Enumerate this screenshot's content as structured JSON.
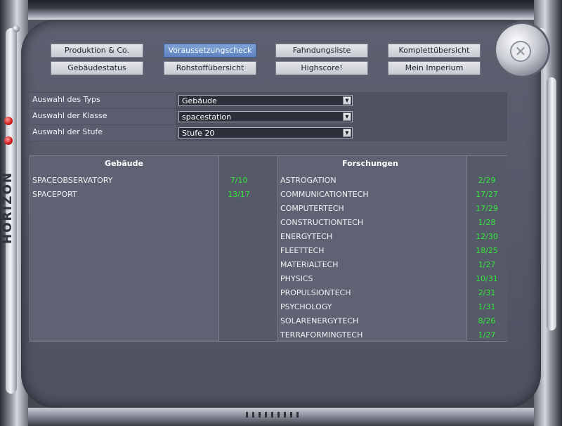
{
  "brand": "HORIZON",
  "nav": {
    "row1": [
      "Produktion & Co.",
      "Voraussetzungscheck",
      "Fahndungsliste",
      "Komplettübersicht"
    ],
    "row2": [
      "Gebäudestatus",
      "Rohstoffübersicht",
      "Highscore!",
      "Mein Imperium"
    ],
    "active": "Voraussetzungscheck"
  },
  "selector": {
    "type_label": "Auswahl des Typs",
    "type_value": "Gebäude",
    "class_label": "Auswahl der Klasse",
    "class_value": "spacestation",
    "level_label": "Auswahl der Stufe",
    "level_value": "Stufe 20"
  },
  "table": {
    "buildings_header": "Gebäude",
    "research_header": "Forschungen",
    "buildings": [
      {
        "name": "SPACEOBSERVATORY",
        "value": "7/10"
      },
      {
        "name": "SPACEPORT",
        "value": "13/17"
      }
    ],
    "research": [
      {
        "name": "ASTROGATION",
        "value": "2/29"
      },
      {
        "name": "COMMUNICATIONTECH",
        "value": "17/27"
      },
      {
        "name": "COMPUTERTECH",
        "value": "17/29"
      },
      {
        "name": "CONSTRUCTIONTECH",
        "value": "1/28"
      },
      {
        "name": "ENERGYTECH",
        "value": "12/30"
      },
      {
        "name": "FLEETTECH",
        "value": "18/25"
      },
      {
        "name": "MATERIALTECH",
        "value": "1/27"
      },
      {
        "name": "PHYSICS",
        "value": "10/31"
      },
      {
        "name": "PROPULSIONTECH",
        "value": "2/31"
      },
      {
        "name": "PSYCHOLOGY",
        "value": "1/31"
      },
      {
        "name": "SOLARENERGYTECH",
        "value": "8/26"
      },
      {
        "name": "TERRAFORMINGTECH",
        "value": "1/27"
      }
    ]
  },
  "colors": {
    "value_green": "#35e63c",
    "active_button": "#6d92cc",
    "panel": "#5e6272"
  }
}
